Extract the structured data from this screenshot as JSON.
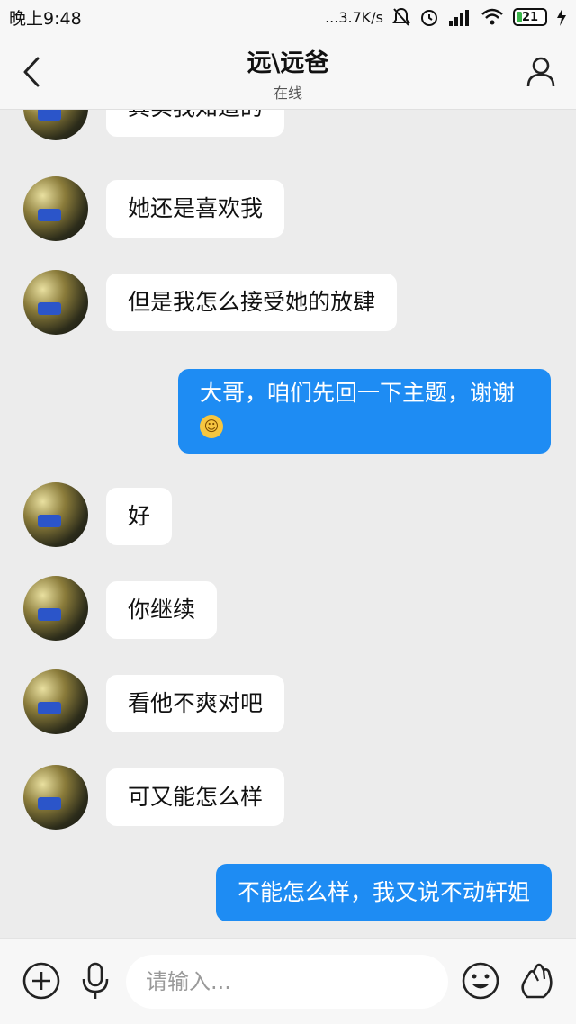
{
  "status_bar": {
    "time": "晚上9:48",
    "network_speed": "...3.7K/s",
    "battery": "21"
  },
  "header": {
    "title": "远\\远爸",
    "subtitle": "在线"
  },
  "messages": [
    {
      "side": "in",
      "text": "其实我知道的"
    },
    {
      "side": "in",
      "text": "她还是喜欢我"
    },
    {
      "side": "in",
      "text": "但是我怎么接受她的放肆"
    },
    {
      "side": "out",
      "text": "大哥，咱们先回一下主题，谢谢"
    },
    {
      "side": "in",
      "text": "好"
    },
    {
      "side": "in",
      "text": "你继续"
    },
    {
      "side": "in",
      "text": "看他不爽对吧"
    },
    {
      "side": "in",
      "text": "可又能怎么样"
    },
    {
      "side": "out",
      "text": "不能怎么样，我又说不动轩姐"
    }
  ],
  "input": {
    "placeholder": "请输入..."
  },
  "icons": {
    "back": "chevron-left-icon",
    "profile": "person-icon",
    "add": "plus-circle-icon",
    "voice": "microphone-icon",
    "emoji": "smiley-icon",
    "gesture": "hand-gesture-icon"
  },
  "colors": {
    "outgoing_bubble": "#1e8cf3",
    "incoming_bubble": "#ffffff",
    "background": "#ececec"
  }
}
